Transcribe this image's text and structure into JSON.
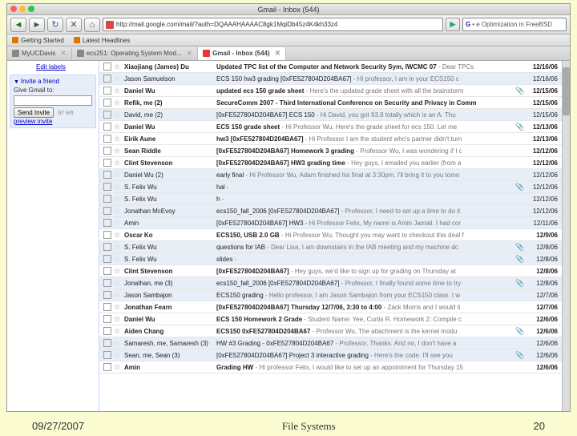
{
  "window": {
    "title": "Gmail - Inbox (544)"
  },
  "nav": {
    "url": "http://mail.google.com/mail/?auth=DQAAAHAAAAC8gk1MqiDb45z4K4kh33z4",
    "back": "◄",
    "forward": "►",
    "reload": "↻",
    "stop": "✕",
    "home": "⌂",
    "go": "▶",
    "search_engine": "G",
    "search_sep": "•",
    "search_text": "e Optimization in FreeBSD"
  },
  "bookmarks": {
    "getting_started": "Getting Started",
    "latest_headlines": "Latest Headlines"
  },
  "tabs": {
    "t1": "MyUCDavis",
    "t2": "ecs251: Operating System Mod...",
    "t3": "Gmail - Inbox (544)",
    "close": "✕"
  },
  "sidebar": {
    "edit_labels": "Edit labels",
    "invite_title": "Invite a friend",
    "give_label": "Give Gmail to:",
    "invite_placeholder": "",
    "send_btn": "Send Invite",
    "left_hint": "97 left",
    "preview": "preview invite"
  },
  "mails": [
    {
      "read": false,
      "sender": "Xiaojiang (James) Du",
      "subject": "Updated TPC list of the Computer and Network Security Sym, IWCMC 07",
      "snippet": " - Dear TPCs",
      "attach": false,
      "date": "12/16/06"
    },
    {
      "read": true,
      "sender": "Jason Samuelson",
      "subject": "ECS 150 hw3 grading [0xFE527804D204BA67]",
      "snippet": " - Hi professor, I am in your ECS150 c",
      "attach": false,
      "date": "12/16/06"
    },
    {
      "read": false,
      "sender": "Daniel Wu",
      "subject": "updated ecs 150 grade sheet",
      "snippet": " - Here's the updated grade sheet with all the brainstorm",
      "attach": true,
      "date": "12/15/06"
    },
    {
      "read": false,
      "sender": "Refik, me (2)",
      "subject": "SecureComm 2007 - Third International Conference on Security and Privacy in Comm",
      "snippet": "",
      "attach": false,
      "date": "12/15/06"
    },
    {
      "read": true,
      "sender": "David, me (2)",
      "subject": "[0xFE527804D204BA67] ECS 150",
      "snippet": " - Hi David, you got 93.8 totally which is an A. Thu",
      "attach": false,
      "date": "12/15/06"
    },
    {
      "read": false,
      "sender": "Daniel Wu",
      "subject": "ECS 150 grade sheet",
      "snippet": " - Hi Professor Wu, Here's the grade sheet for ecs 150. Let me",
      "attach": true,
      "date": "12/13/06"
    },
    {
      "read": false,
      "sender": "Eirik Aune",
      "subject": "hw3 [0xFE527804D204BA67]",
      "snippet": " - Hi Professor I am the student who's partner didn't turn",
      "attach": false,
      "date": "12/13/06"
    },
    {
      "read": false,
      "sender": "Sean Riddle",
      "subject": "[0xFE527804D204BA67] Homework 3 grading",
      "snippet": " - Professor Wu, I was wondering if I c",
      "attach": false,
      "date": "12/12/06"
    },
    {
      "read": false,
      "sender": "Clint Stevenson",
      "subject": "[0xFE527804D204BA67] HW3 grading time",
      "snippet": " - Hey guys, I emailed you earlier (from a",
      "attach": false,
      "date": "12/12/06"
    },
    {
      "read": true,
      "sender": "Daniel Wu (2)",
      "subject": "early final",
      "snippet": " - Hi Professor Wu, Adam finished his final at 3:30pm. I'll bring it to you tomo",
      "attach": false,
      "date": "12/12/06"
    },
    {
      "read": true,
      "sender": "S. Felix Wu",
      "subject": "hal",
      "snippet": " -",
      "attach": true,
      "date": "12/12/06"
    },
    {
      "read": true,
      "sender": "S. Felix Wu",
      "subject": "h",
      "snippet": " -",
      "attach": false,
      "date": "12/12/06"
    },
    {
      "read": true,
      "sender": "Jonathan McEvoy",
      "subject": "ecs150_fall_2006 [0xFE527804D204BA67]",
      "snippet": " - Professor, I need to set up a time to do it",
      "attach": false,
      "date": "12/12/06"
    },
    {
      "read": true,
      "sender": "Amin",
      "subject": "[0xFE527804D204BA67] HW3",
      "snippet": " - Hi Professor Felix, My name is Amin Jamali. I had cor",
      "attach": false,
      "date": "12/11/06"
    },
    {
      "read": false,
      "sender": "Oscar Ko",
      "subject": "ECS150, USB 2.0 GB",
      "snippet": " - Hi Professor Wu, Thought you may want to checkout this deal f",
      "attach": false,
      "date": "12/9/06"
    },
    {
      "read": true,
      "sender": "S. Felix Wu",
      "subject": "questions for IAB",
      "snippet": " - Dear Lisa, I am downstairs in the IAB meeting and my machine dc",
      "attach": true,
      "date": "12/8/06"
    },
    {
      "read": true,
      "sender": "S. Felix Wu",
      "subject": "slides",
      "snippet": " -",
      "attach": true,
      "date": "12/8/06"
    },
    {
      "read": false,
      "sender": "Clint Stevenson",
      "subject": "[0xFE527804D204BA67]",
      "snippet": " - Hey guys, we'd like to sign up for grading on Thursday at",
      "attach": false,
      "date": "12/8/06"
    },
    {
      "read": true,
      "sender": "Jonathan, me (3)",
      "subject": "ecs150_fall_2006 [0xFE527804D204BA67]",
      "snippet": " - Professor, I finally found some time to try",
      "attach": true,
      "date": "12/8/06"
    },
    {
      "read": true,
      "sender": "Jason Sambajon",
      "subject": "ECS150 grading",
      "snippet": " - Hello professor, I am Jason Sambajon from your ECS150 class. I w",
      "attach": false,
      "date": "12/7/06"
    },
    {
      "read": false,
      "sender": "Jonathan Fearn",
      "subject": "[0xFE527804D204BA67] Thursday 12/7/06, 3:30 to 4:00",
      "snippet": " - Zack Morris and I would li",
      "attach": false,
      "date": "12/7/06"
    },
    {
      "read": false,
      "sender": "Daniel Wu",
      "subject": "ECS 150 Homework 2 Grade",
      "snippet": " - Student Name: Yee, Curtis R. Homework 2: Compile c",
      "attach": false,
      "date": "12/6/06"
    },
    {
      "read": false,
      "sender": "Aiden Chang",
      "subject": "ECS150 0xFE527804D204BA67",
      "snippet": " - Professor Wu, The attachment is the kernel modu",
      "attach": true,
      "date": "12/6/06"
    },
    {
      "read": true,
      "sender": "Samaresh, me, Samaresh (3)",
      "subject": "HW #3 Grading - 0xFE527804D204BA67",
      "snippet": " - Professor, Thanks. And no, I don't have a",
      "attach": false,
      "date": "12/6/06"
    },
    {
      "read": true,
      "sender": "Sean, me, Sean (3)",
      "subject": "[0xFE527804D204BA67] Project 3 interactive grading",
      "snippet": " - Here's the code. I'll see you",
      "attach": true,
      "date": "12/6/06"
    },
    {
      "read": false,
      "sender": "Amin",
      "subject": "Grading HW",
      "snippet": " - Hi professor Felix, I would like to set up an appointment for Thursday 15",
      "attach": false,
      "date": "12/6/06"
    }
  ],
  "footer": {
    "date": "09/27/2007",
    "title": "File Systems",
    "page": "20"
  }
}
